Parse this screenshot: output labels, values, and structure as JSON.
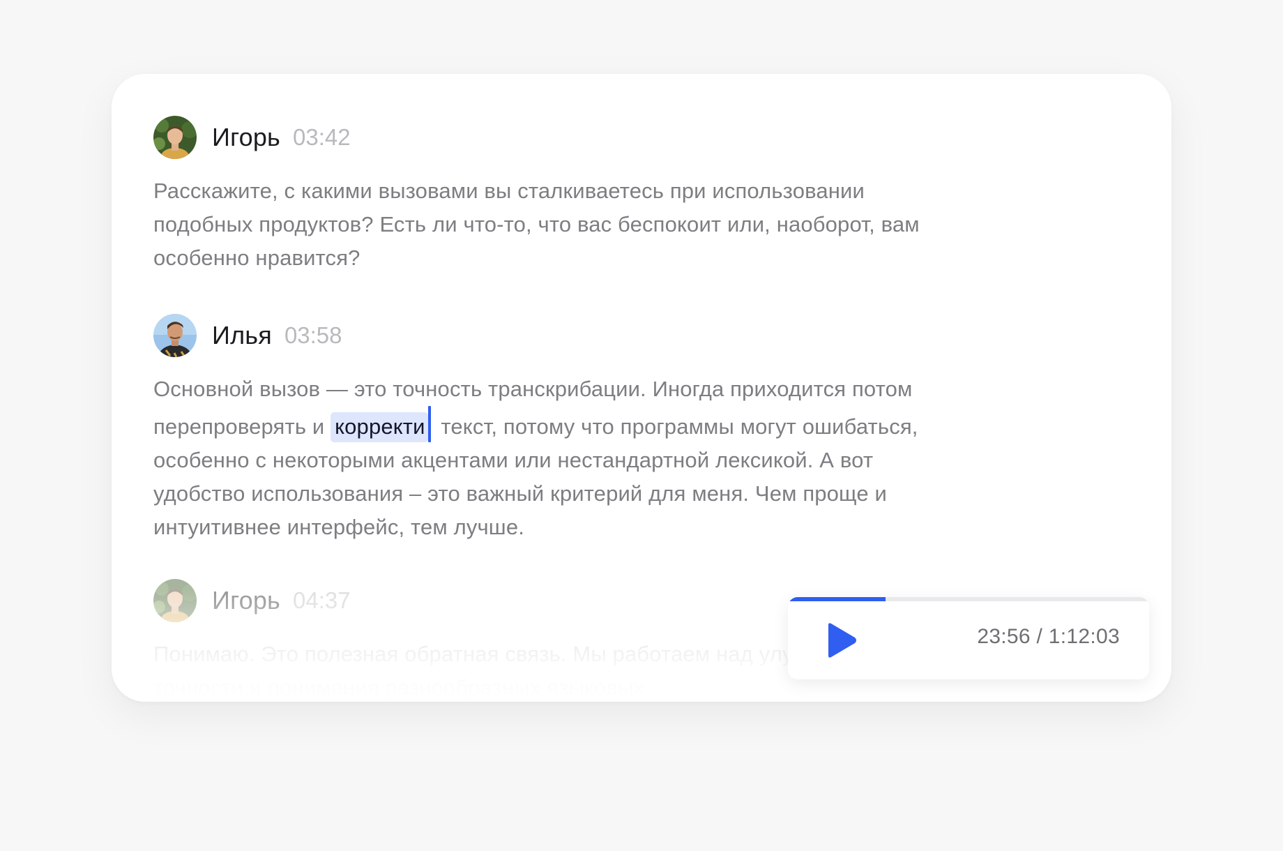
{
  "messages": [
    {
      "speaker": "Игорь",
      "time": "03:42",
      "text": "Расскажите, с какими вызовами вы сталкиваетесь при использовании подобных продуктов? Есть ли что-то, что вас беспокоит или, наоборот, вам особенно нравится?"
    },
    {
      "speaker": "Илья",
      "time": "03:58",
      "text_before": "Основной вызов — это точность транскрибации. Иногда приходится потом перепроверять и ",
      "highlight": "корректи",
      "text_after": " текст, потому что программы могут ошибаться, особенно с некоторыми акцентами или нестандартной лексикой. А вот удобство использования – это важный критерий для меня. Чем проще и интуитивнее интерфейс, тем лучше."
    },
    {
      "speaker": "Игорь",
      "time": "04:37",
      "text": "Понимаю. Это полезная обратная связь. Мы работаем над улучшением точности и понимания разнообразных языковых"
    }
  ],
  "player": {
    "time_display": "23:56 / 1:12:03",
    "progress": 0.27,
    "accent_color": "#2f5ef0",
    "play_icon": "play-icon"
  }
}
